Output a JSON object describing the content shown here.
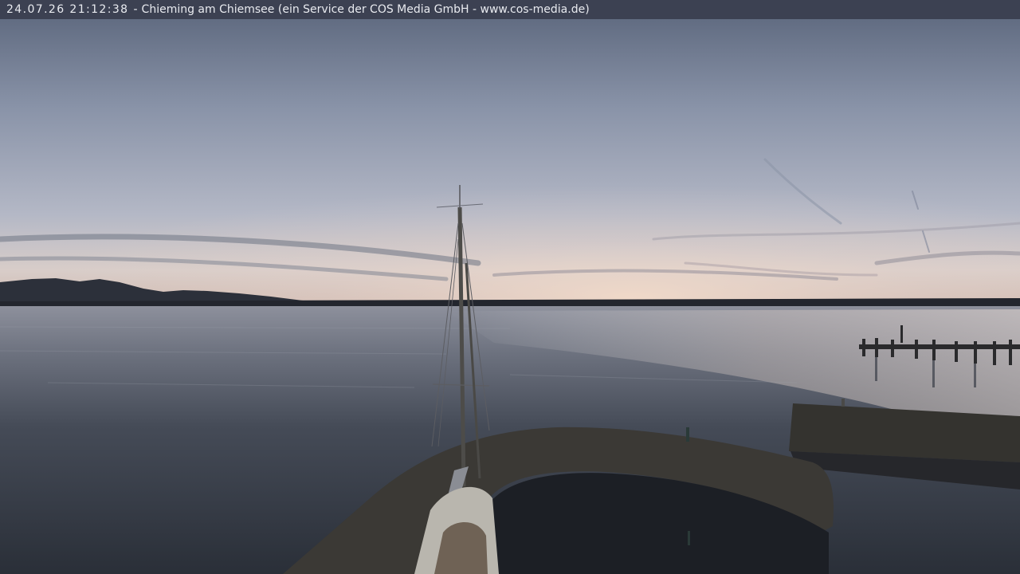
{
  "overlay": {
    "timestamp": "24.07.26 21:12:38",
    "separator": "-",
    "caption": "Chieming am Chiemsee (ein Service der COS Media GmbH - www.cos-media.de)"
  },
  "colors": {
    "sky_top": "#5f6a7c",
    "sky_mid": "#a6adbf",
    "horizon_glow": "#e8d2c4",
    "water": "#2f3640",
    "mountains": "#2a2d36",
    "jetty": "#33322f"
  }
}
